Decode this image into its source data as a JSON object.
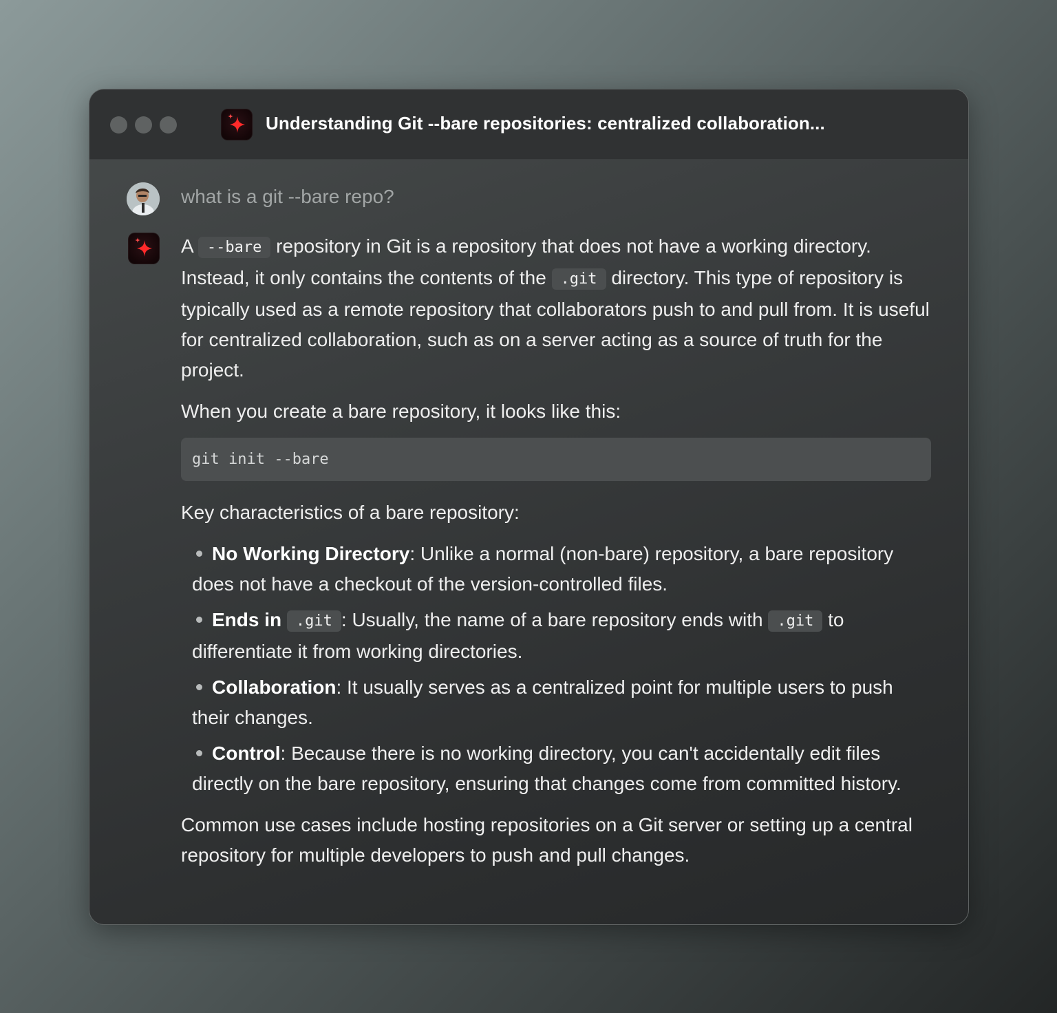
{
  "window": {
    "title": "Understanding Git --bare repositories: centralized collaboration..."
  },
  "icons": {
    "app": "sparkle-icon",
    "user": "avatar"
  },
  "user_message": "what is a git --bare repo?",
  "answer": {
    "p1": {
      "a": "A ",
      "code1": "--bare",
      "b": " repository in Git is a repository that does not have a working directory. Instead, it only contains the contents of the ",
      "code2": ".git",
      "c": " directory. This type of repository is typically used as a remote repository that collaborators push to and pull from. It is useful for centralized collaboration, such as on a server acting as a source of truth for the project."
    },
    "p2": "When you create a bare repository, it looks like this:",
    "code_block": "git init --bare",
    "p3": "Key characteristics of a bare repository:",
    "bullets": [
      {
        "title": "No Working Directory",
        "text": ": Unlike a normal (non-bare) repository, a bare repository does not have a checkout of the version-controlled files."
      },
      {
        "title": "Ends in ",
        "code": ".git",
        "text_a": ": Usually, the name of a bare repository ends with ",
        "code2": ".git",
        "text_b": " to differentiate it from working directories."
      },
      {
        "title": "Collaboration",
        "text": ": It usually serves as a centralized point for multiple users to push their changes."
      },
      {
        "title": "Control",
        "text": ": Because there is no working directory, you can't accidentally edit files directly on the bare repository, ensuring that changes come from committed history."
      }
    ],
    "p4": "Common use cases include hosting repositories on a Git server or setting up a central repository for multiple developers to push and pull changes."
  }
}
